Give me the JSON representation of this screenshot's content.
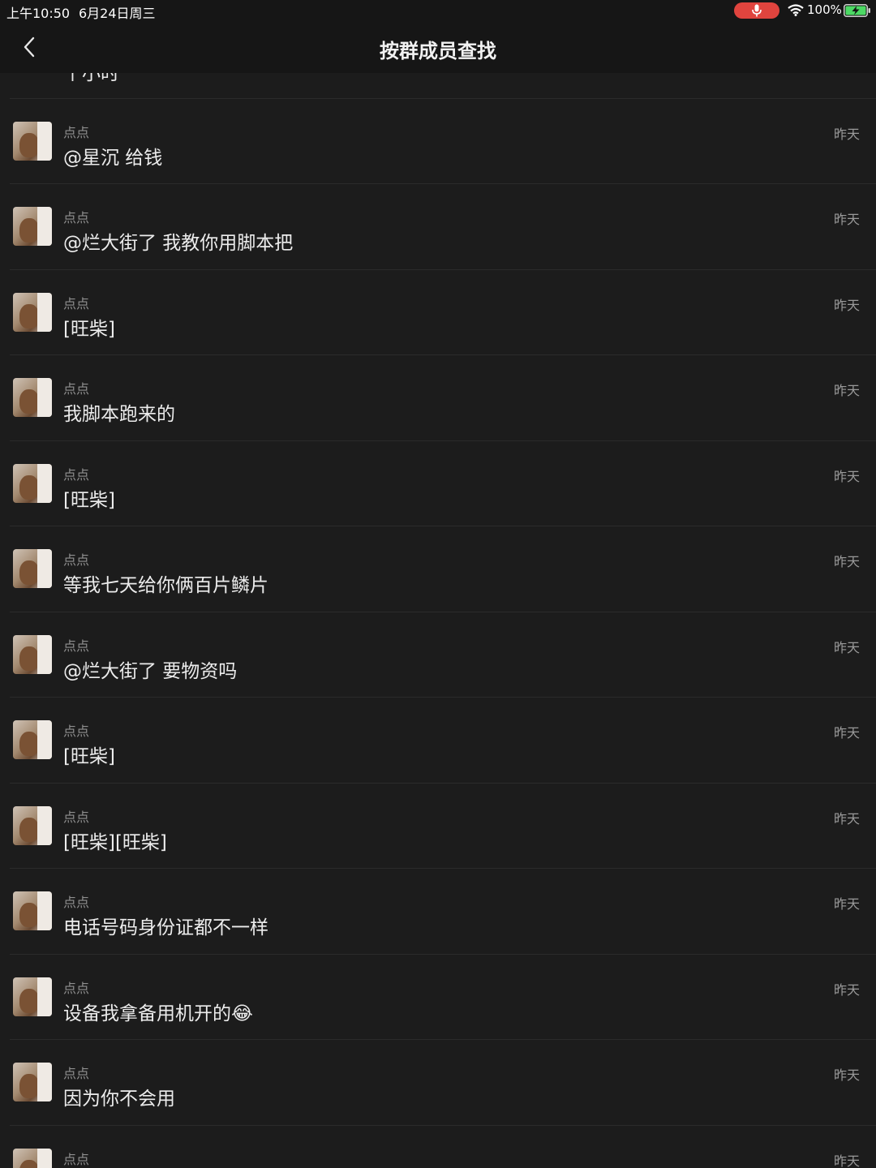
{
  "status_bar": {
    "time": "上午10:50",
    "date": "6月24日周三",
    "battery": "100%",
    "mic_color": "#e0443e",
    "battery_color": "#4cd964"
  },
  "nav": {
    "title": "按群成员查找",
    "back_icon": "chevron-left-icon"
  },
  "top_partial_message": "个小时",
  "messages": [
    {
      "sender": "点点",
      "text": "@星沉 给钱",
      "time": "昨天"
    },
    {
      "sender": "点点",
      "text": "@烂大街了 我教你用脚本把",
      "time": "昨天"
    },
    {
      "sender": "点点",
      "text": "[旺柴]",
      "time": "昨天"
    },
    {
      "sender": "点点",
      "text": "我脚本跑来的",
      "time": "昨天"
    },
    {
      "sender": "点点",
      "text": "[旺柴]",
      "time": "昨天"
    },
    {
      "sender": "点点",
      "text": "等我七天给你俩百片鳞片",
      "time": "昨天"
    },
    {
      "sender": "点点",
      "text": "@烂大街了 要物资吗",
      "time": "昨天"
    },
    {
      "sender": "点点",
      "text": "[旺柴]",
      "time": "昨天"
    },
    {
      "sender": "点点",
      "text": "[旺柴][旺柴]",
      "time": "昨天"
    },
    {
      "sender": "点点",
      "text": "电话号码身份证都不一样",
      "time": "昨天"
    },
    {
      "sender": "点点",
      "text": "设备我拿备用机开的😂",
      "time": "昨天"
    },
    {
      "sender": "点点",
      "text": "因为你不会用",
      "time": "昨天"
    },
    {
      "sender": "点点",
      "text": "",
      "time": "昨天"
    }
  ]
}
